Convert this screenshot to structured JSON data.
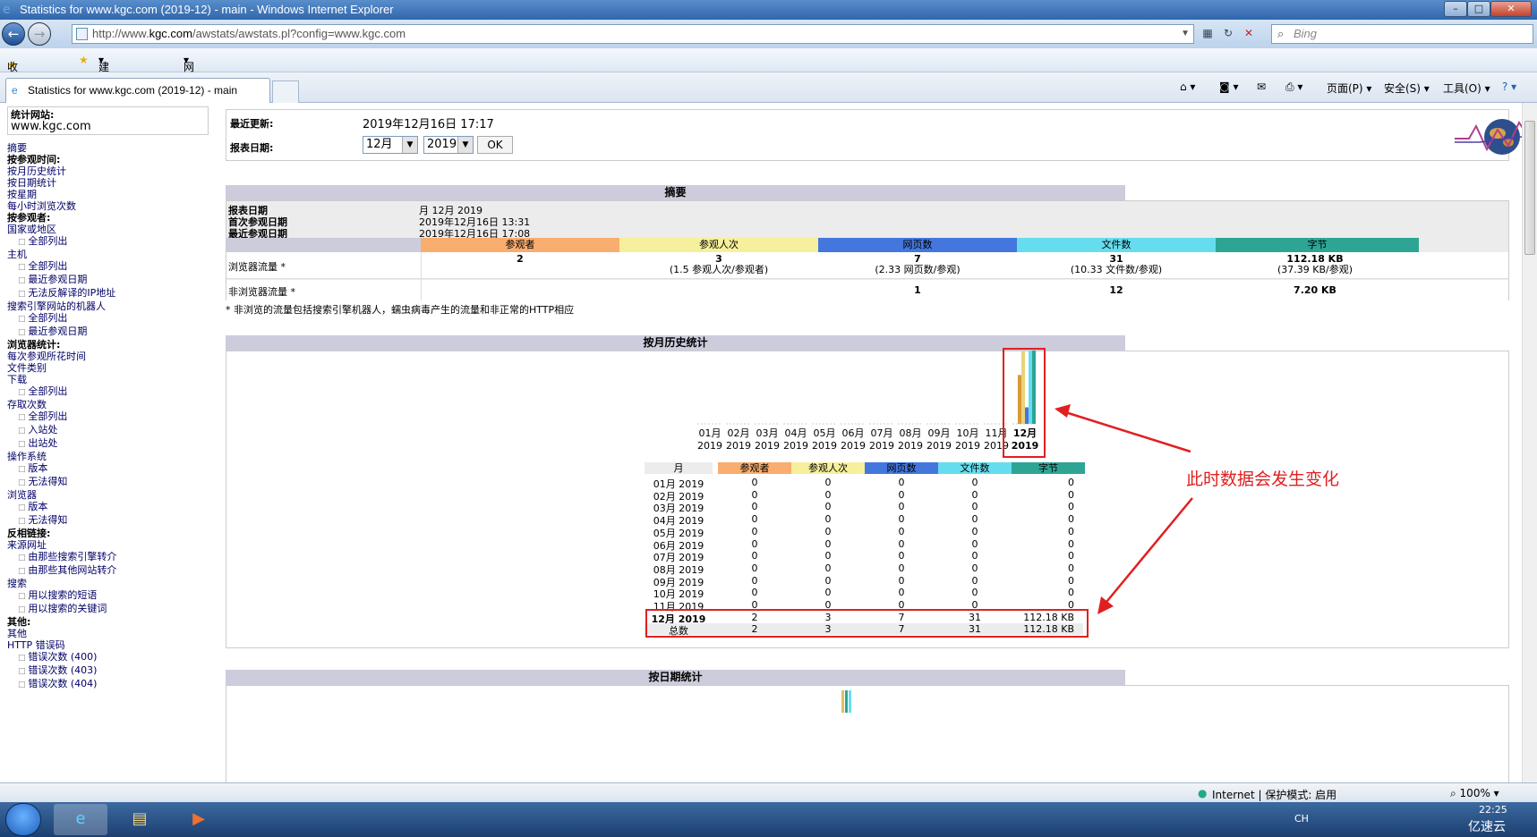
{
  "window": {
    "title": "Statistics for www.kgc.com (2019-12) - main - Windows Internet Explorer",
    "controls": [
      "–",
      "□",
      "✕"
    ]
  },
  "address_bar": {
    "url_prefix": "http://www.",
    "url_domain": "kgc.com",
    "url_path": "/awstats/awstats.pl?config=www.kgc.com",
    "search_placeholder": "Bing"
  },
  "favorites_bar": {
    "favorites": "收藏夹",
    "suggested_sites": "建议网站",
    "web_slice": "网页快讯库"
  },
  "tab": {
    "label": "Statistics for www.kgc.com (2019-12) - main"
  },
  "command_bar": {
    "page": "页面(P)",
    "safety": "安全(S)",
    "tools": "工具(O)"
  },
  "sidebar": {
    "site_label": "统计网站:",
    "site_value": "www.kgc.com",
    "items": [
      {
        "text": "摘要",
        "type": "link"
      },
      {
        "text": "按参观时间:",
        "type": "head"
      },
      {
        "text": "按月历史统计",
        "type": "link"
      },
      {
        "text": "按日期统计",
        "type": "link"
      },
      {
        "text": "按星期",
        "type": "link"
      },
      {
        "text": "每小时浏览次数",
        "type": "link"
      },
      {
        "text": "按参观者:",
        "type": "head"
      },
      {
        "text": "国家或地区",
        "type": "link"
      },
      {
        "text": "全部列出",
        "type": "sub"
      },
      {
        "text": "主机",
        "type": "link"
      },
      {
        "text": "全部列出",
        "type": "sub"
      },
      {
        "text": "最近参观日期",
        "type": "sub"
      },
      {
        "text": "无法反解译的IP地址",
        "type": "sub"
      },
      {
        "text": "搜索引擎网站的机器人",
        "type": "link"
      },
      {
        "text": "全部列出",
        "type": "sub"
      },
      {
        "text": "最近参观日期",
        "type": "sub"
      },
      {
        "text": "浏览器统计:",
        "type": "head"
      },
      {
        "text": "每次参观所花时间",
        "type": "link"
      },
      {
        "text": "文件类别",
        "type": "link"
      },
      {
        "text": "下载",
        "type": "link"
      },
      {
        "text": "全部列出",
        "type": "sub"
      },
      {
        "text": "存取次数",
        "type": "link"
      },
      {
        "text": "全部列出",
        "type": "sub"
      },
      {
        "text": "入站处",
        "type": "sub"
      },
      {
        "text": "出站处",
        "type": "sub"
      },
      {
        "text": "操作系统",
        "type": "link"
      },
      {
        "text": "版本",
        "type": "sub"
      },
      {
        "text": "无法得知",
        "type": "sub"
      },
      {
        "text": "浏览器",
        "type": "link"
      },
      {
        "text": "版本",
        "type": "sub"
      },
      {
        "text": "无法得知",
        "type": "sub"
      },
      {
        "text": "反相链接:",
        "type": "head"
      },
      {
        "text": "来源网址",
        "type": "link"
      },
      {
        "text": "由那些搜索引擎转介",
        "type": "sub"
      },
      {
        "text": "由那些其他网站转介",
        "type": "sub"
      },
      {
        "text": "搜索",
        "type": "link"
      },
      {
        "text": "用以搜索的短语",
        "type": "sub"
      },
      {
        "text": "用以搜索的关键词",
        "type": "sub"
      },
      {
        "text": "其他:",
        "type": "head"
      },
      {
        "text": "其他",
        "type": "link"
      },
      {
        "text": "HTTP 错误码",
        "type": "link"
      },
      {
        "text": "错误次数 (400)",
        "type": "sub"
      },
      {
        "text": "错误次数 (403)",
        "type": "sub"
      },
      {
        "text": "错误次数 (404)",
        "type": "sub"
      }
    ]
  },
  "header_box": {
    "last_update_label": "最近更新:",
    "last_update_value": "2019年12月16日 17:17",
    "report_date_label": "报表日期:",
    "month": "12月",
    "year": "2019",
    "ok": "OK"
  },
  "summary": {
    "title": "摘要",
    "report_date_label": "报表日期",
    "report_date_value": "月 12月 2019",
    "first_visit_label": "首次参观日期",
    "first_visit_value": "2019年12月16日 13:31",
    "last_visit_label": "最近参观日期",
    "last_visit_value": "2019年12月16日 17:08",
    "columns": [
      "参观者",
      "参观人次",
      "网页数",
      "文件数",
      "字节"
    ],
    "column_colors": [
      "#f9ad6f",
      "#f6f09c",
      "#4477dd",
      "#66ddee",
      "#2ea495"
    ],
    "browser_label": "浏览器流量 *",
    "browser_values": [
      "2",
      "3",
      "7",
      "31",
      "112.18 KB"
    ],
    "browser_sub": [
      "",
      "(1.5 参观人次/参观者)",
      "(2.33 网页数/参观)",
      "(10.33 文件数/参观)",
      "(37.39 KB/参观)"
    ],
    "nonbrowser_label": "非浏览器流量 *",
    "nonbrowser_values": [
      "",
      "",
      "1",
      "12",
      "7.20 KB"
    ],
    "footnote": "* 非浏览的流量包括搜索引擎机器人，蠕虫病毒产生的流量和非正常的HTTP相应"
  },
  "monthly": {
    "title": "按月历史统计",
    "months": [
      "01月",
      "02月",
      "03月",
      "04月",
      "05月",
      "06月",
      "07月",
      "08月",
      "09月",
      "10月",
      "11月",
      "12月"
    ],
    "year": "2019",
    "table_headers": [
      "月",
      "参观者",
      "参观人次",
      "网页数",
      "文件数",
      "字节"
    ],
    "rows": [
      [
        "01月 2019",
        "0",
        "0",
        "0",
        "0",
        "0"
      ],
      [
        "02月 2019",
        "0",
        "0",
        "0",
        "0",
        "0"
      ],
      [
        "03月 2019",
        "0",
        "0",
        "0",
        "0",
        "0"
      ],
      [
        "04月 2019",
        "0",
        "0",
        "0",
        "0",
        "0"
      ],
      [
        "05月 2019",
        "0",
        "0",
        "0",
        "0",
        "0"
      ],
      [
        "06月 2019",
        "0",
        "0",
        "0",
        "0",
        "0"
      ],
      [
        "07月 2019",
        "0",
        "0",
        "0",
        "0",
        "0"
      ],
      [
        "08月 2019",
        "0",
        "0",
        "0",
        "0",
        "0"
      ],
      [
        "09月 2019",
        "0",
        "0",
        "0",
        "0",
        "0"
      ],
      [
        "10月 2019",
        "0",
        "0",
        "0",
        "0",
        "0"
      ],
      [
        "11月 2019",
        "0",
        "0",
        "0",
        "0",
        "0"
      ]
    ],
    "current_row": [
      "12月 2019",
      "2",
      "3",
      "7",
      "31",
      "112.18 KB"
    ],
    "total_row": [
      "总数",
      "2",
      "3",
      "7",
      "31",
      "112.18 KB"
    ],
    "annotation": "此时数据会发生变化"
  },
  "daily": {
    "title": "按日期统计"
  },
  "statusbar": {
    "zone": "Internet | 保护模式: 启用",
    "zoom": "100%"
  },
  "taskbar": {
    "lang": "CH",
    "time": "22:25",
    "watermark": "亿速云"
  }
}
